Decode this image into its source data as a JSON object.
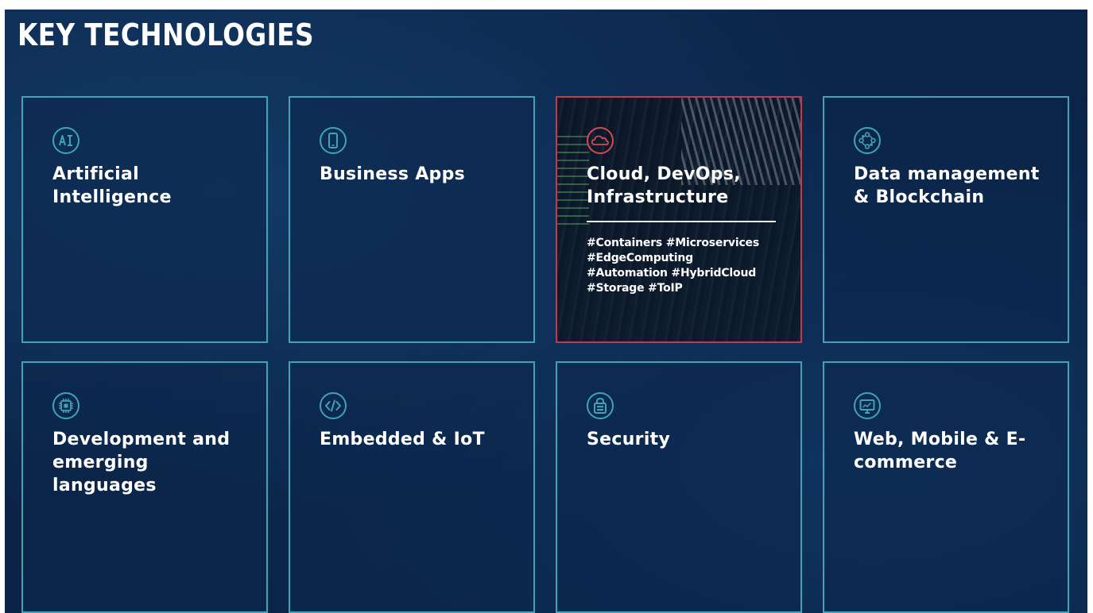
{
  "header": {
    "title": "KEY TECHNOLOGIES"
  },
  "colors": {
    "card_border": "#3fa4b5",
    "active_border": "#c8374a",
    "icon_teal": "#3fa4b5",
    "icon_red": "#d44a55",
    "background": "#0b2447"
  },
  "cards": [
    {
      "title": "Artificial Intelligence",
      "icon": "ai-icon"
    },
    {
      "title": "Business Apps",
      "icon": "smartphone-icon"
    },
    {
      "title": "Cloud, DevOps, Infrastructure",
      "icon": "cloud-icon",
      "active": true,
      "tags": [
        "#Containers #Microservices",
        "#EdgeComputing",
        "#Automation #HybridCloud",
        "#Storage #ToIP"
      ]
    },
    {
      "title": "Data management & Blockchain",
      "icon": "network-nodes-icon"
    },
    {
      "title": "Development and emerging languages",
      "icon": "chip-icon"
    },
    {
      "title": "Embedded & IoT",
      "icon": "code-icon"
    },
    {
      "title": "Security",
      "icon": "shield-lock-icon"
    },
    {
      "title": "Web, Mobile & E-commerce",
      "icon": "monitor-icon"
    }
  ]
}
